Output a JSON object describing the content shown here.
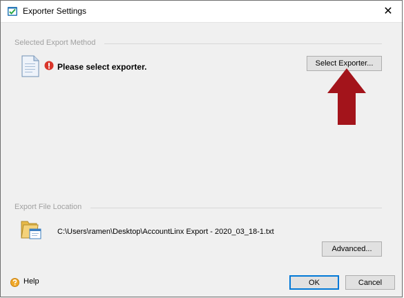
{
  "window": {
    "title": "Exporter Settings",
    "close_glyph": "✕",
    "icon": "checklist-icon"
  },
  "export_method": {
    "section_label": "Selected Export Method",
    "status_text": "Please select exporter.",
    "status_icon": "error-icon",
    "doc_icon": "document-icon",
    "select_button_label": "Select Exporter..."
  },
  "annotation": {
    "arrow_color": "#a3141b",
    "icon": "up-arrow-icon"
  },
  "export_file": {
    "section_label": "Export File Location",
    "folder_icon": "folder-window-icon",
    "path": "C:\\Users\\ramen\\Desktop\\AccountLinx Export - 2020_03_18-1.txt",
    "advanced_button_label": "Advanced..."
  },
  "footer": {
    "help_label": "Help",
    "help_icon": "help-icon",
    "ok_label": "OK",
    "cancel_label": "Cancel"
  }
}
